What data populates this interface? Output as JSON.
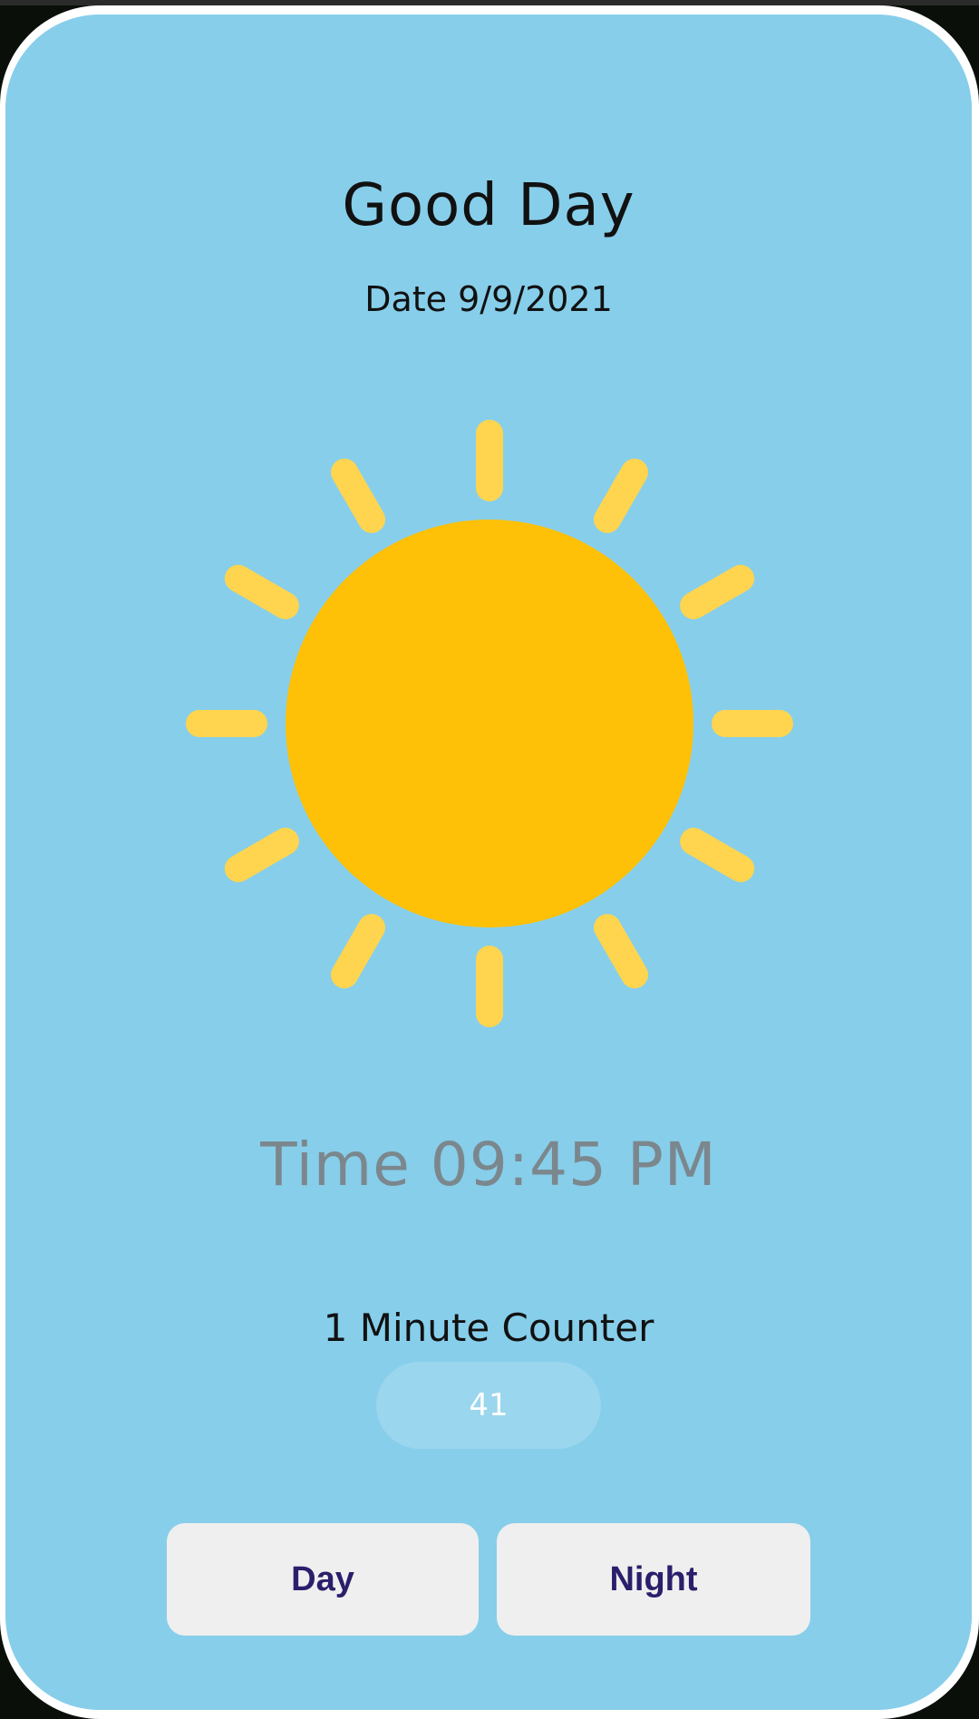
{
  "header": {
    "greeting": "Good Day",
    "date": "Date 9/9/2021"
  },
  "illustration": {
    "icon": "sun-icon",
    "sun_color": "#FFC107",
    "ray_color": "#FFD54F"
  },
  "clock": {
    "time": "Time 09:45 PM"
  },
  "counter": {
    "label": "1 Minute Counter",
    "value": "41"
  },
  "buttons": {
    "day_label": "Day",
    "night_label": "Night"
  },
  "colors": {
    "background": "#87CEEA",
    "button_text": "#2A1F6B",
    "time_text": "#7B878D"
  }
}
